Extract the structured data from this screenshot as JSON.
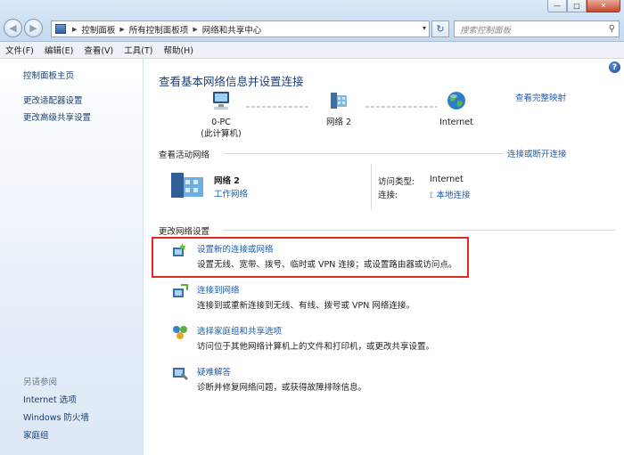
{
  "window": {
    "buttons": {
      "minimize": "—",
      "maximize": "□",
      "close": "✕"
    }
  },
  "navbar": {
    "back": "◀",
    "forward": "▶",
    "breadcrumb": [
      "控制面板",
      "所有控制面板项",
      "网络和共享中心"
    ],
    "refresh": "↻",
    "search_placeholder": "搜索控制面板",
    "dropdown": "▾"
  },
  "menubar": [
    "文件(F)",
    "编辑(E)",
    "查看(V)",
    "工具(T)",
    "帮助(H)"
  ],
  "sidebar": {
    "items": [
      "控制面板主页",
      "更改适配器设置",
      "更改高级共享设置"
    ],
    "see_also_title": "另请参阅",
    "see_also": [
      "Internet 选项",
      "Windows 防火墙",
      "家庭组"
    ]
  },
  "main": {
    "title": "查看基本网络信息并设置连接",
    "full_map": "查看完整映射",
    "map": {
      "computer": "0-PC",
      "computer_sub": "(此计算机)",
      "network": "网络  2",
      "internet": "Internet"
    },
    "active_header": "查看活动网络",
    "disconnect": "连接或断开连接",
    "active_network": {
      "name": "网络  2",
      "type": "工作网络",
      "access_label": "访问类型:",
      "access_value": "Internet",
      "conn_label": "连接:",
      "conn_value": "本地连接"
    },
    "change_header": "更改网络设置",
    "tasks": [
      {
        "link": "设置新的连接或网络",
        "desc": "设置无线、宽带、拨号、临时或 VPN 连接；或设置路由器或访问点。"
      },
      {
        "link": "连接到网络",
        "desc": "连接到或重新连接到无线、有线、拨号或 VPN 网络连接。"
      },
      {
        "link": "选择家庭组和共享选项",
        "desc": "访问位于其他网络计算机上的文件和打印机，或更改共享设置。"
      },
      {
        "link": "疑难解答",
        "desc": "诊断并修复网络问题，或获得故障排除信息。"
      }
    ]
  }
}
